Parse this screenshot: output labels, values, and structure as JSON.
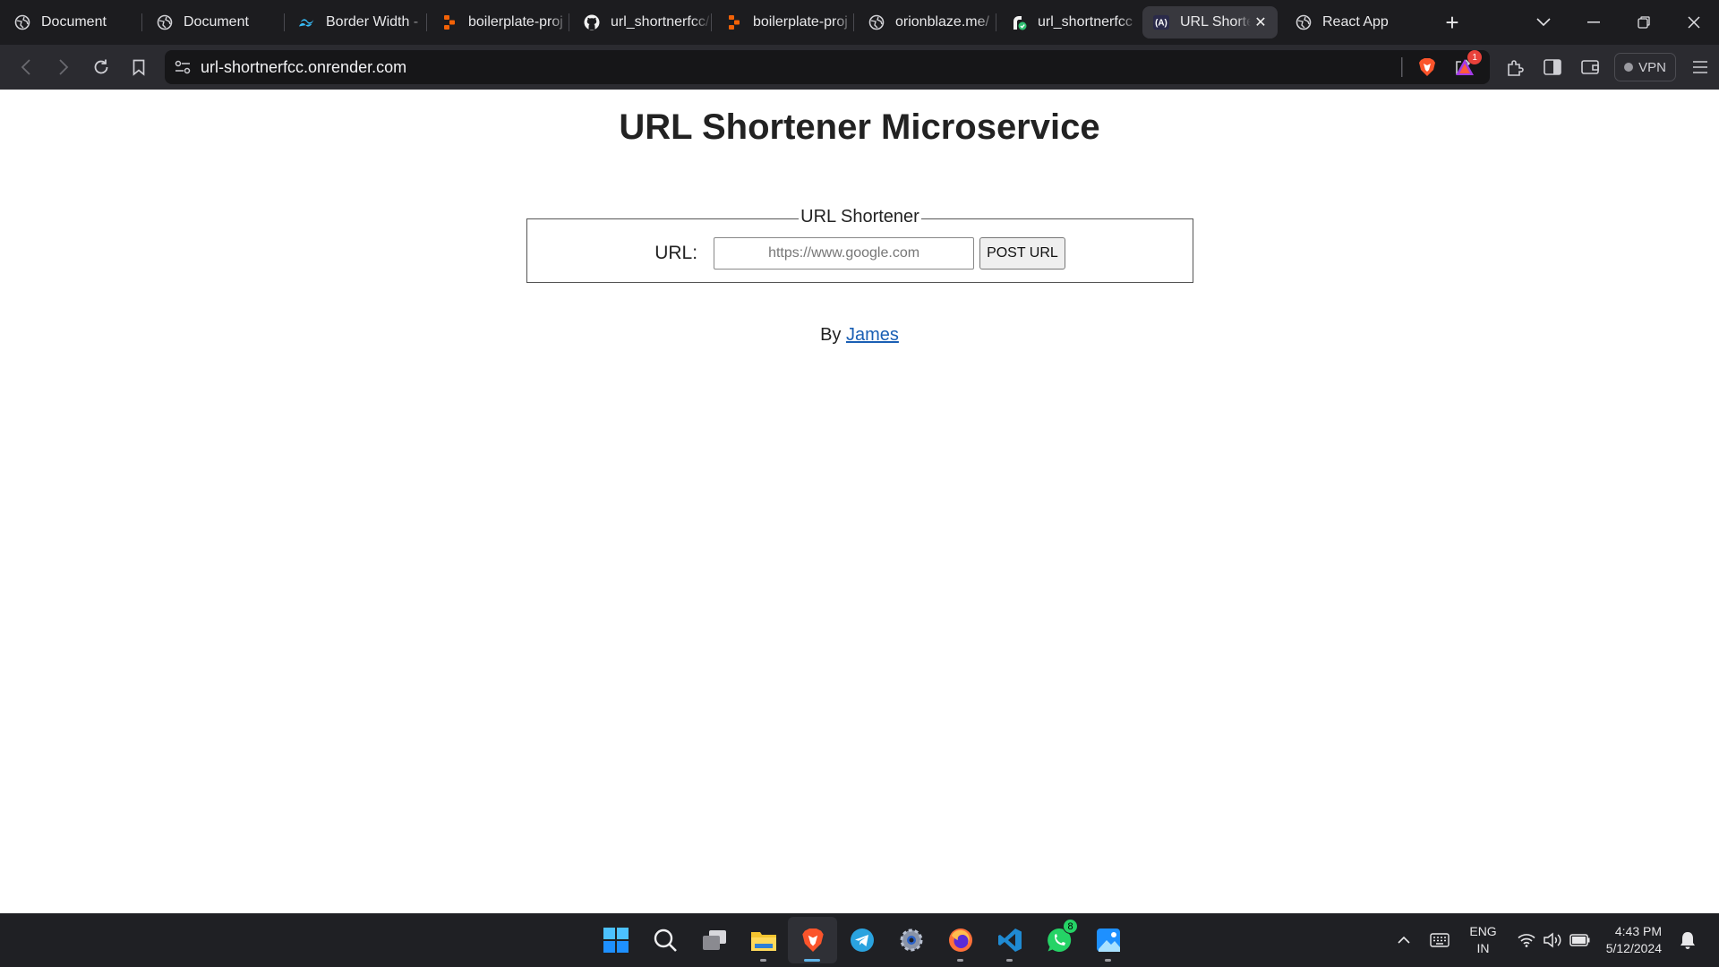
{
  "browser": {
    "tabs": [
      {
        "title": "Document",
        "icon": "globe-icon"
      },
      {
        "title": "Document",
        "icon": "globe-icon"
      },
      {
        "title": "Border Width -",
        "icon": "tailwind-icon"
      },
      {
        "title": "boilerplate-proj",
        "icon": "replit-icon"
      },
      {
        "title": "url_shortnerfcc/",
        "icon": "github-icon"
      },
      {
        "title": "boilerplate-proj",
        "icon": "replit-icon"
      },
      {
        "title": "orionblaze.me/",
        "icon": "globe-icon"
      },
      {
        "title": "url_shortnerfcc",
        "icon": "render-icon"
      },
      {
        "title": "URL Shorte",
        "icon": "app-icon",
        "active": true
      },
      {
        "title": "React App",
        "icon": "globe-icon"
      }
    ],
    "address": "url-shortnerfcc.onrender.com",
    "vpn_label": "VPN",
    "rewards_badge": "1"
  },
  "page": {
    "title": "URL Shortener Microservice",
    "legend": "URL Shortener",
    "url_label": "URL:",
    "url_placeholder": "https://www.google.com",
    "submit_label": "POST URL",
    "by_text": "By",
    "author": "James"
  },
  "taskbar": {
    "whatsapp_badge": "8",
    "lang_line1": "ENG",
    "lang_line2": "IN",
    "time": "4:43 PM",
    "date": "5/12/2024"
  },
  "colors": {
    "tab_bar": "#1c1c1f",
    "toolbar": "#2b2b30",
    "link": "#1a5fb4",
    "taskbar": "#1f2024"
  }
}
